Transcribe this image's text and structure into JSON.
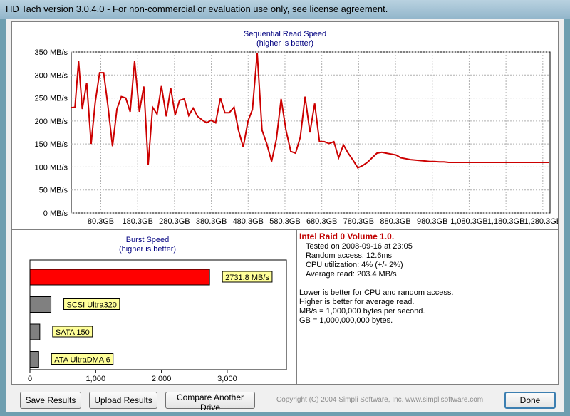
{
  "window": {
    "title": "HD Tach version 3.0.4.0  - For non-commercial or evaluation use only, see license agreement."
  },
  "sequential": {
    "chart_data": {
      "type": "line",
      "title": "Sequential Read Speed",
      "subtitle": "(higher is better)",
      "y_ticks": [
        "0 MB/s",
        "50 MB/s",
        "100 MB/s",
        "150 MB/s",
        "200 MB/s",
        "250 MB/s",
        "300 MB/s",
        "350 MB/s"
      ],
      "x_ticks": [
        "80.3GB",
        "180.3GB",
        "280.3GB",
        "380.3GB",
        "480.3GB",
        "580.3GB",
        "680.3GB",
        "780.3GB",
        "880.3GB",
        "980.3GB",
        "1,080.3GB",
        "1,180.3GB",
        "1,280.3GB"
      ],
      "x_tick_values": [
        80.3,
        180.3,
        280.3,
        380.3,
        480.3,
        580.3,
        680.3,
        780.3,
        880.3,
        980.3,
        1080.3,
        1180.3,
        1280.3
      ],
      "xlim": [
        0,
        1300
      ],
      "ylim": [
        0,
        350
      ],
      "grid": true,
      "color": "#cc0000",
      "x": [
        0,
        10,
        20,
        30,
        42,
        54,
        65,
        77,
        88,
        100,
        112,
        124,
        136,
        148,
        160,
        172,
        185,
        197,
        209,
        221,
        233,
        245,
        258,
        270,
        282,
        294,
        307,
        319,
        331,
        343,
        356,
        368,
        380,
        392,
        405,
        417,
        429,
        442,
        454,
        467,
        480,
        492,
        505,
        518,
        531,
        544,
        557,
        570,
        583,
        596,
        609,
        622,
        635,
        648,
        661,
        674,
        687,
        700,
        713,
        726,
        739,
        752,
        765,
        778,
        791,
        804,
        817,
        830,
        843,
        856,
        869,
        882,
        895,
        908,
        921,
        934,
        947,
        960,
        973,
        986,
        999,
        1012,
        1025,
        1038,
        1051,
        1064,
        1077,
        1090,
        1103,
        1116,
        1129,
        1142,
        1155,
        1168,
        1181,
        1194,
        1207,
        1220,
        1233,
        1246,
        1259,
        1272,
        1285,
        1298
      ],
      "values": [
        229,
        230,
        330,
        226,
        283,
        150,
        240,
        305,
        305,
        230,
        145,
        226,
        253,
        250,
        220,
        330,
        220,
        275,
        105,
        230,
        215,
        276,
        210,
        272,
        213,
        245,
        248,
        212,
        228,
        210,
        202,
        196,
        202,
        196,
        250,
        218,
        218,
        230,
        180,
        143,
        200,
        225,
        348,
        180,
        150,
        112,
        160,
        248,
        180,
        134,
        130,
        165,
        253,
        175,
        238,
        155,
        155,
        151,
        155,
        120,
        148,
        130,
        115,
        98,
        103,
        110,
        120,
        130,
        132,
        130,
        128,
        126,
        120,
        118,
        116,
        115,
        114,
        113,
        112,
        112,
        111,
        111,
        110,
        110,
        110,
        110,
        110,
        110,
        110,
        110,
        110,
        110,
        110,
        110,
        110,
        110,
        110,
        110,
        110,
        110,
        110,
        110,
        110,
        110
      ]
    }
  },
  "burst": {
    "chart_data": {
      "type": "bar",
      "title": "Burst Speed",
      "subtitle": "(higher is better)",
      "categories": [
        "2731.8 MB/s",
        "SCSI Ultra320",
        "SATA 150",
        "ATA UltraDMA 6"
      ],
      "values": [
        2731.8,
        320,
        150,
        133
      ],
      "colors": [
        "#ff0000",
        "#808080",
        "#808080",
        "#808080"
      ],
      "x_ticks": [
        "0",
        "1,000",
        "2,000",
        "3,000"
      ],
      "x_tick_values": [
        0,
        1000,
        2000,
        3000
      ],
      "xlim": [
        0,
        3900
      ],
      "label_color": "#ffff99"
    }
  },
  "info": {
    "title": "Intel Raid 0 Volume 1.0.",
    "lines": [
      "Tested on 2008-09-16 at 23:05",
      "Random access: 12.6ms",
      "CPU utilization: 4% (+/- 2%)",
      "Average read: 203.4 MB/s"
    ],
    "notes": [
      "Lower is better for CPU and random access.",
      "Higher is better for average read.",
      "MB/s = 1,000,000 bytes per second.",
      "GB = 1,000,000,000 bytes."
    ]
  },
  "buttons": {
    "save": "Save Results",
    "upload": "Upload Results",
    "compare": "Compare Another Drive",
    "done": "Done"
  },
  "copyright": "Copyright (C) 2004 Simpli Software, Inc. www.simplisoftware.com"
}
